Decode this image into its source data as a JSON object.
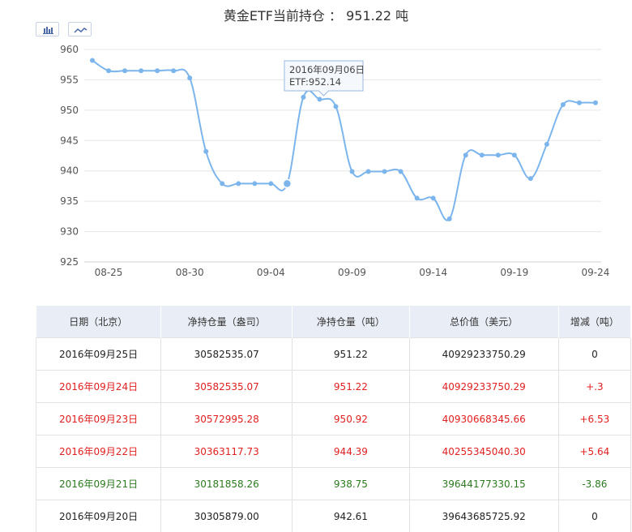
{
  "title": "黄金ETF当前持仓 ： 951.22 吨",
  "toolbar": {
    "bar_icon": "bar-chart-icon",
    "line_icon": "line-chart-icon"
  },
  "chart_data": {
    "type": "line",
    "x": [
      "2016-08-25",
      "2016-08-26",
      "2016-08-27",
      "2016-08-28",
      "2016-08-29",
      "2016-08-30",
      "2016-08-31",
      "2016-09-01",
      "2016-09-02",
      "2016-09-03",
      "2016-09-04",
      "2016-09-05",
      "2016-09-06",
      "2016-09-07",
      "2016-09-08",
      "2016-09-09",
      "2016-09-10",
      "2016-09-11",
      "2016-09-12",
      "2016-09-13",
      "2016-09-14",
      "2016-09-15",
      "2016-09-16",
      "2016-09-17",
      "2016-09-18",
      "2016-09-19",
      "2016-09-20",
      "2016-09-21",
      "2016-09-22",
      "2016-09-23",
      "2016-09-24",
      "2016-09-25"
    ],
    "series": [
      {
        "name": "ETF",
        "values": [
          958.2,
          956.5,
          956.5,
          956.5,
          956.5,
          956.5,
          955.3,
          943.2,
          937.9,
          937.9,
          937.9,
          937.9,
          937.9,
          952.14,
          951.8,
          950.6,
          939.9,
          939.9,
          939.9,
          939.9,
          935.5,
          935.5,
          932.1,
          942.6,
          942.6,
          942.6,
          942.6,
          938.75,
          944.39,
          950.92,
          951.22,
          951.22
        ]
      }
    ],
    "x_tick_labels": [
      "08-25",
      "08-30",
      "09-04",
      "09-09",
      "09-14",
      "09-19",
      "09-24"
    ],
    "y_ticks": [
      925,
      930,
      935,
      940,
      945,
      950,
      955,
      960
    ],
    "ylim": [
      925,
      960
    ],
    "grid": true,
    "color": "#7cb5ec",
    "tooltip": {
      "date": "2016年09月06日",
      "label": "ETF:952.14"
    }
  },
  "table": {
    "headers": [
      "日期（北京）",
      "净持仓量（盎司）",
      "净持仓量（吨）",
      "总价值（美元）",
      "增减（吨）"
    ],
    "rows": [
      {
        "tone": "black",
        "cells": [
          "2016年09月25日",
          "30582535.07",
          "951.22",
          "40929233750.29",
          "0"
        ]
      },
      {
        "tone": "red",
        "cells": [
          "2016年09月24日",
          "30582535.07",
          "951.22",
          "40929233750.29",
          "+.3"
        ]
      },
      {
        "tone": "red",
        "cells": [
          "2016年09月23日",
          "30572995.28",
          "950.92",
          "40930668345.66",
          "+6.53"
        ]
      },
      {
        "tone": "red",
        "cells": [
          "2016年09月22日",
          "30363117.73",
          "944.39",
          "40255345040.30",
          "+5.64"
        ]
      },
      {
        "tone": "green",
        "cells": [
          "2016年09月21日",
          "30181858.26",
          "938.75",
          "39644177330.15",
          "-3.86"
        ]
      },
      {
        "tone": "black",
        "cells": [
          "2016年09月20日",
          "30305879.00",
          "942.61",
          "39643685725.92",
          "0"
        ]
      }
    ]
  }
}
